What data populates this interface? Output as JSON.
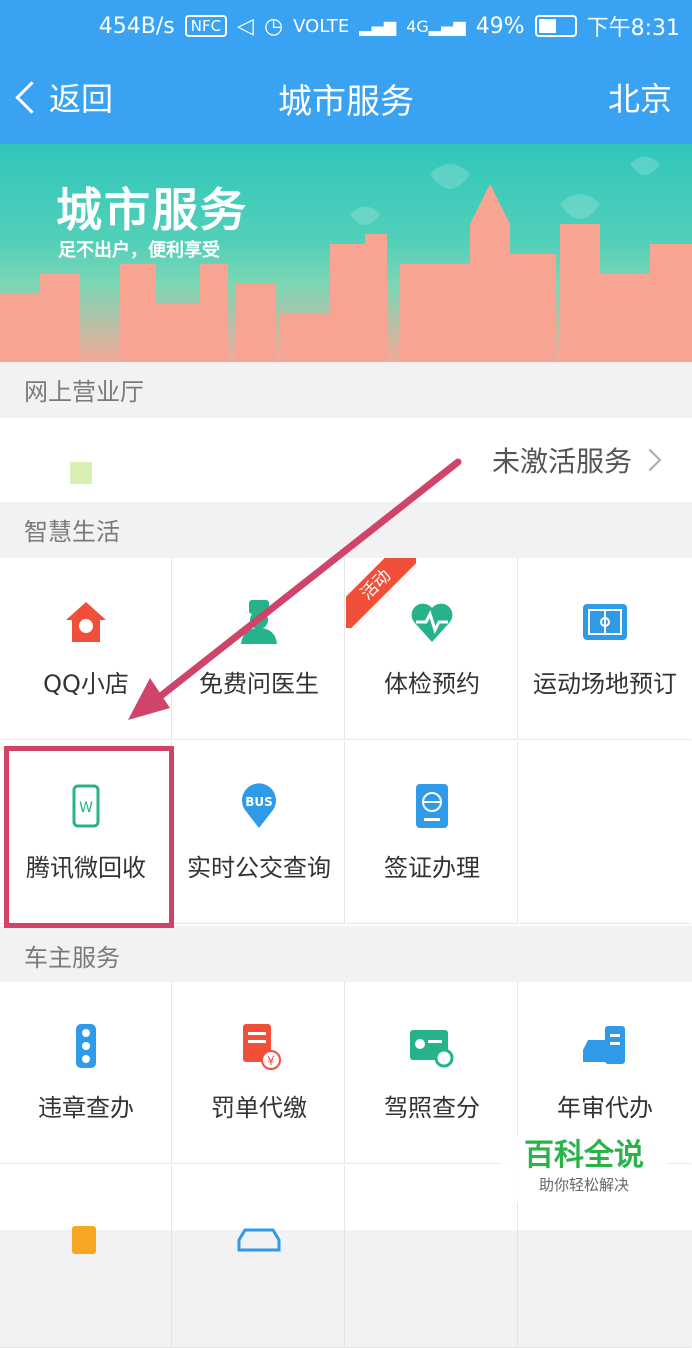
{
  "status": {
    "speed": "454B/s",
    "nfc": "NFC",
    "network": "VOLTE",
    "battery": "49%",
    "time": "下午8:31"
  },
  "nav": {
    "back": "返回",
    "title": "城市服务",
    "city": "北京"
  },
  "banner": {
    "title": "城市服务",
    "subtitle": "足不出户，便利享受"
  },
  "sections": {
    "online_hall": "网上营业厅",
    "smart_life": "智慧生活",
    "car_owner": "车主服务"
  },
  "online_hall": {
    "status": "未激活服务"
  },
  "badge": "活动",
  "smart_life": [
    {
      "label": "QQ小店",
      "icon": "house-icon",
      "color": "#f0503a"
    },
    {
      "label": "免费问医生",
      "icon": "doctor-icon",
      "color": "#26b38c"
    },
    {
      "label": "体检预约",
      "icon": "heart-icon",
      "color": "#26b38c"
    },
    {
      "label": "运动场地预订",
      "icon": "court-icon",
      "color": "#2f9be8"
    },
    {
      "label": "腾讯微回收",
      "icon": "phone-recycle-icon",
      "color": "#26b38c"
    },
    {
      "label": "实时公交查询",
      "icon": "bus-icon",
      "color": "#2f9be8"
    },
    {
      "label": "签证办理",
      "icon": "passport-icon",
      "color": "#2f9be8"
    }
  ],
  "car_owner": [
    {
      "label": "违章查办",
      "icon": "traffic-light-icon",
      "color": "#2f9be8"
    },
    {
      "label": "罚单代缴",
      "icon": "ticket-icon",
      "color": "#f0503a"
    },
    {
      "label": "驾照查分",
      "icon": "license-icon",
      "color": "#26b38c"
    },
    {
      "label": "年审代办",
      "icon": "car-inspect-icon",
      "color": "#2f9be8"
    }
  ],
  "watermark": {
    "title": "百科全说",
    "subtitle": "助你轻松解决"
  }
}
